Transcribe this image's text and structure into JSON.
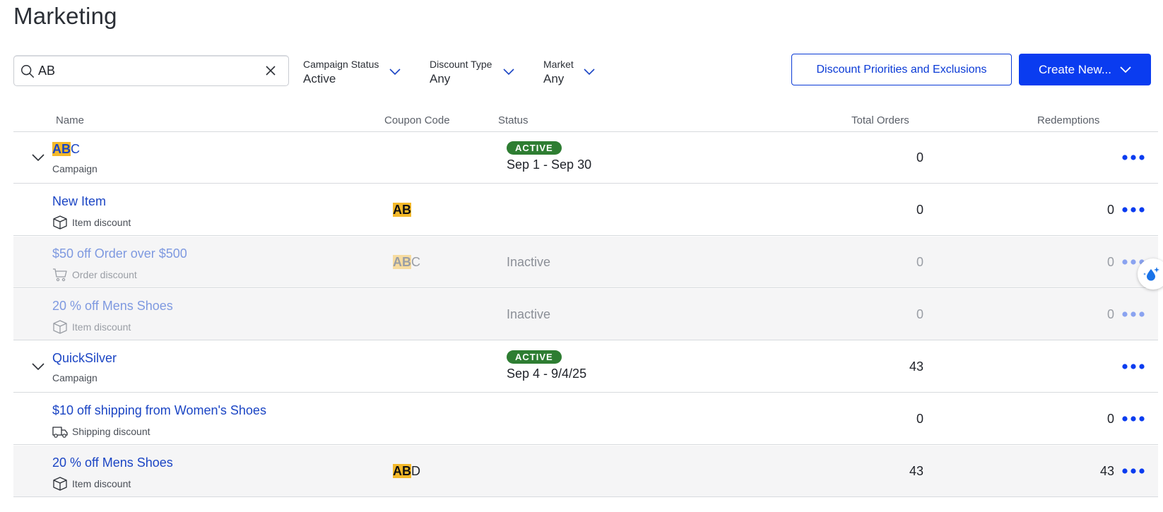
{
  "page": {
    "title": "Marketing"
  },
  "search": {
    "value": "AB",
    "placeholder": ""
  },
  "filters": [
    {
      "label": "Campaign Status",
      "value": "Active"
    },
    {
      "label": "Discount Type",
      "value": "Any"
    },
    {
      "label": "Market",
      "value": "Any"
    }
  ],
  "buttons": {
    "priorities": "Discount Priorities and Exclusions",
    "create": "Create New..."
  },
  "columns": {
    "name": "Name",
    "coupon": "Coupon Code",
    "status": "Status",
    "orders": "Total Orders",
    "redemptions": "Redemptions"
  },
  "rows": [
    {
      "type": "campaign",
      "name_hl": "AB",
      "name_rest": "C",
      "sub": "Campaign",
      "badge": "ACTIVE",
      "dates": "Sep 1  - Sep 30",
      "orders": "0",
      "redemptions": ""
    },
    {
      "type": "item",
      "name": "New Item",
      "sub": "Item discount",
      "icon": "box-icon",
      "coupon_hl": "AB",
      "coupon_rest": "",
      "status": "",
      "orders": "0",
      "redemptions": "0"
    },
    {
      "type": "item",
      "name": "$50 off Order over $500",
      "sub": "Order discount",
      "icon": "cart-icon",
      "coupon_hl": "AB",
      "coupon_rest": "C",
      "status": "Inactive",
      "orders": "0",
      "redemptions": "0"
    },
    {
      "type": "item",
      "name": "20 % off Mens Shoes",
      "sub": "Item discount",
      "icon": "box-icon",
      "coupon_hl": "",
      "coupon_rest": "",
      "status": "Inactive",
      "orders": "0",
      "redemptions": "0"
    },
    {
      "type": "campaign",
      "name": "QuickSilver",
      "sub": "Campaign",
      "badge": "ACTIVE",
      "dates": "Sep 4 - 9/4/25",
      "orders": "43",
      "redemptions": ""
    },
    {
      "type": "item",
      "name": "$10 off shipping from Women's Shoes",
      "sub": "Shipping discount",
      "icon": "truck-icon",
      "coupon_hl": "",
      "coupon_rest": "",
      "status": "",
      "orders": "0",
      "redemptions": "0"
    },
    {
      "type": "item",
      "name": "20 % off Mens Shoes",
      "sub": "Item discount",
      "icon": "box-icon",
      "coupon_hl": "AB",
      "coupon_rest": "D",
      "status": "",
      "orders": "43",
      "redemptions": "43"
    }
  ],
  "colors": {
    "accent": "#0a3cf0",
    "link": "#1b45c4",
    "highlight": "#f4b92a",
    "active_badge": "#2e7d32",
    "row_muted_bg": "#f5f5f6"
  }
}
